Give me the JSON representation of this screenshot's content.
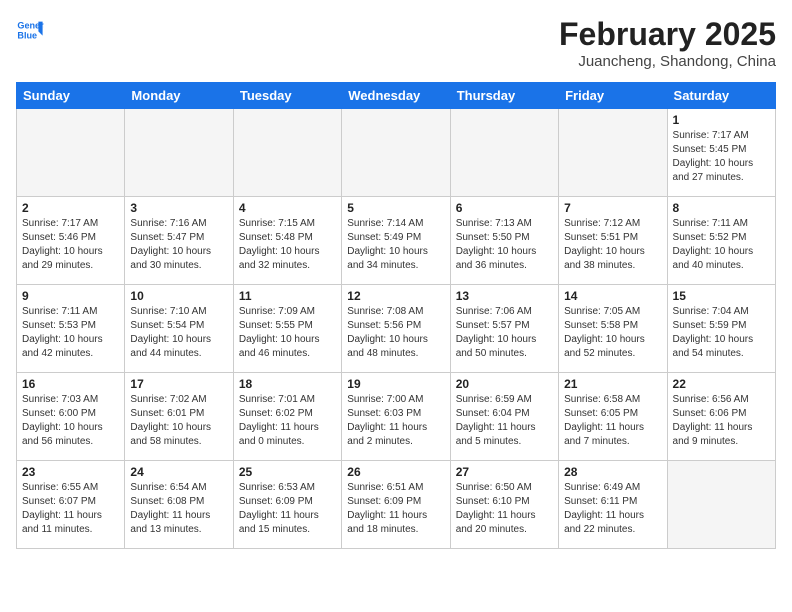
{
  "header": {
    "logo_line1": "General",
    "logo_line2": "Blue",
    "month_title": "February 2025",
    "location": "Juancheng, Shandong, China"
  },
  "weekdays": [
    "Sunday",
    "Monday",
    "Tuesday",
    "Wednesday",
    "Thursday",
    "Friday",
    "Saturday"
  ],
  "weeks": [
    [
      {
        "day": null,
        "info": null
      },
      {
        "day": null,
        "info": null
      },
      {
        "day": null,
        "info": null
      },
      {
        "day": null,
        "info": null
      },
      {
        "day": null,
        "info": null
      },
      {
        "day": null,
        "info": null
      },
      {
        "day": "1",
        "info": "Sunrise: 7:17 AM\nSunset: 5:45 PM\nDaylight: 10 hours and 27 minutes."
      }
    ],
    [
      {
        "day": "2",
        "info": "Sunrise: 7:17 AM\nSunset: 5:46 PM\nDaylight: 10 hours and 29 minutes."
      },
      {
        "day": "3",
        "info": "Sunrise: 7:16 AM\nSunset: 5:47 PM\nDaylight: 10 hours and 30 minutes."
      },
      {
        "day": "4",
        "info": "Sunrise: 7:15 AM\nSunset: 5:48 PM\nDaylight: 10 hours and 32 minutes."
      },
      {
        "day": "5",
        "info": "Sunrise: 7:14 AM\nSunset: 5:49 PM\nDaylight: 10 hours and 34 minutes."
      },
      {
        "day": "6",
        "info": "Sunrise: 7:13 AM\nSunset: 5:50 PM\nDaylight: 10 hours and 36 minutes."
      },
      {
        "day": "7",
        "info": "Sunrise: 7:12 AM\nSunset: 5:51 PM\nDaylight: 10 hours and 38 minutes."
      },
      {
        "day": "8",
        "info": "Sunrise: 7:11 AM\nSunset: 5:52 PM\nDaylight: 10 hours and 40 minutes."
      }
    ],
    [
      {
        "day": "9",
        "info": "Sunrise: 7:11 AM\nSunset: 5:53 PM\nDaylight: 10 hours and 42 minutes."
      },
      {
        "day": "10",
        "info": "Sunrise: 7:10 AM\nSunset: 5:54 PM\nDaylight: 10 hours and 44 minutes."
      },
      {
        "day": "11",
        "info": "Sunrise: 7:09 AM\nSunset: 5:55 PM\nDaylight: 10 hours and 46 minutes."
      },
      {
        "day": "12",
        "info": "Sunrise: 7:08 AM\nSunset: 5:56 PM\nDaylight: 10 hours and 48 minutes."
      },
      {
        "day": "13",
        "info": "Sunrise: 7:06 AM\nSunset: 5:57 PM\nDaylight: 10 hours and 50 minutes."
      },
      {
        "day": "14",
        "info": "Sunrise: 7:05 AM\nSunset: 5:58 PM\nDaylight: 10 hours and 52 minutes."
      },
      {
        "day": "15",
        "info": "Sunrise: 7:04 AM\nSunset: 5:59 PM\nDaylight: 10 hours and 54 minutes."
      }
    ],
    [
      {
        "day": "16",
        "info": "Sunrise: 7:03 AM\nSunset: 6:00 PM\nDaylight: 10 hours and 56 minutes."
      },
      {
        "day": "17",
        "info": "Sunrise: 7:02 AM\nSunset: 6:01 PM\nDaylight: 10 hours and 58 minutes."
      },
      {
        "day": "18",
        "info": "Sunrise: 7:01 AM\nSunset: 6:02 PM\nDaylight: 11 hours and 0 minutes."
      },
      {
        "day": "19",
        "info": "Sunrise: 7:00 AM\nSunset: 6:03 PM\nDaylight: 11 hours and 2 minutes."
      },
      {
        "day": "20",
        "info": "Sunrise: 6:59 AM\nSunset: 6:04 PM\nDaylight: 11 hours and 5 minutes."
      },
      {
        "day": "21",
        "info": "Sunrise: 6:58 AM\nSunset: 6:05 PM\nDaylight: 11 hours and 7 minutes."
      },
      {
        "day": "22",
        "info": "Sunrise: 6:56 AM\nSunset: 6:06 PM\nDaylight: 11 hours and 9 minutes."
      }
    ],
    [
      {
        "day": "23",
        "info": "Sunrise: 6:55 AM\nSunset: 6:07 PM\nDaylight: 11 hours and 11 minutes."
      },
      {
        "day": "24",
        "info": "Sunrise: 6:54 AM\nSunset: 6:08 PM\nDaylight: 11 hours and 13 minutes."
      },
      {
        "day": "25",
        "info": "Sunrise: 6:53 AM\nSunset: 6:09 PM\nDaylight: 11 hours and 15 minutes."
      },
      {
        "day": "26",
        "info": "Sunrise: 6:51 AM\nSunset: 6:09 PM\nDaylight: 11 hours and 18 minutes."
      },
      {
        "day": "27",
        "info": "Sunrise: 6:50 AM\nSunset: 6:10 PM\nDaylight: 11 hours and 20 minutes."
      },
      {
        "day": "28",
        "info": "Sunrise: 6:49 AM\nSunset: 6:11 PM\nDaylight: 11 hours and 22 minutes."
      },
      {
        "day": null,
        "info": null
      }
    ]
  ]
}
